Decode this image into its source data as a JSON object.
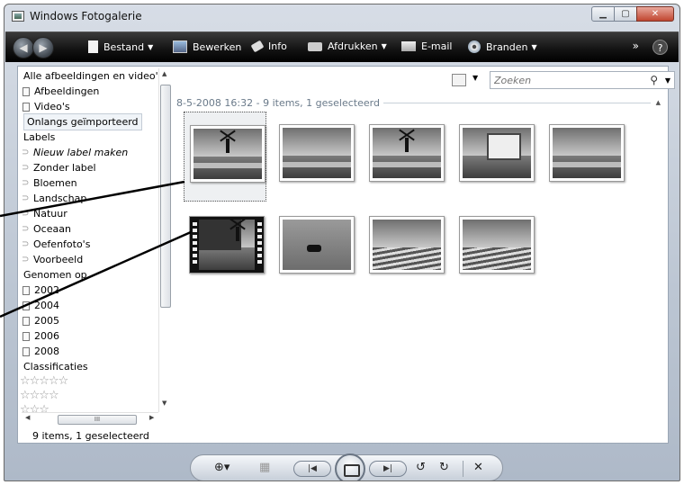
{
  "window": {
    "title": "Windows Fotogalerie"
  },
  "toolbar": {
    "bestand": "Bestand",
    "bewerken": "Bewerken",
    "info": "Info",
    "afdrukken": "Afdrukken",
    "email": "E-mail",
    "branden": "Branden",
    "more": "»",
    "help": "?"
  },
  "sidebar": {
    "items": [
      {
        "label": "Alle afbeeldingen en video's",
        "kind": "head"
      },
      {
        "label": "Afbeeldingen",
        "kind": "doc"
      },
      {
        "label": "Video's",
        "kind": "doc"
      },
      {
        "label": "Onlangs geïmporteerd",
        "kind": "selected"
      },
      {
        "label": "Labels",
        "kind": "head"
      },
      {
        "label": "Nieuw label maken",
        "kind": "tag-italic"
      },
      {
        "label": "Zonder label",
        "kind": "tag"
      },
      {
        "label": "Bloemen",
        "kind": "tag"
      },
      {
        "label": "Landschap",
        "kind": "tag"
      },
      {
        "label": "Natuur",
        "kind": "tag"
      },
      {
        "label": "Oceaan",
        "kind": "tag"
      },
      {
        "label": "Oefenfoto's",
        "kind": "tag"
      },
      {
        "label": "Voorbeeld",
        "kind": "tag"
      },
      {
        "label": "Genomen op",
        "kind": "head"
      },
      {
        "label": "2002",
        "kind": "doc"
      },
      {
        "label": "2004",
        "kind": "doc"
      },
      {
        "label": "2005",
        "kind": "doc"
      },
      {
        "label": "2006",
        "kind": "doc"
      },
      {
        "label": "2008",
        "kind": "doc"
      },
      {
        "label": "Classificaties",
        "kind": "head"
      }
    ],
    "rating_rows": [
      "☆☆☆☆☆",
      "☆☆☆☆",
      "☆☆☆"
    ],
    "hscroll_grip": "III"
  },
  "status": {
    "text": "9 items, 1 geselecteerd"
  },
  "search": {
    "placeholder": "Zoeken"
  },
  "group": {
    "header": "8-5-2008 16:32 - 9 items, 1 geselecteerd"
  },
  "thumbnails": [
    {
      "subject": "windmill",
      "selected": true
    },
    {
      "subject": "field"
    },
    {
      "subject": "windmill"
    },
    {
      "subject": "info-board"
    },
    {
      "subject": "field"
    },
    {
      "subject": "video",
      "video": true
    },
    {
      "subject": "horse"
    },
    {
      "subject": "tulip-field"
    },
    {
      "subject": "tulip-field"
    }
  ],
  "colors": {
    "toolbar": "#141414",
    "accent": "#c0452f"
  }
}
